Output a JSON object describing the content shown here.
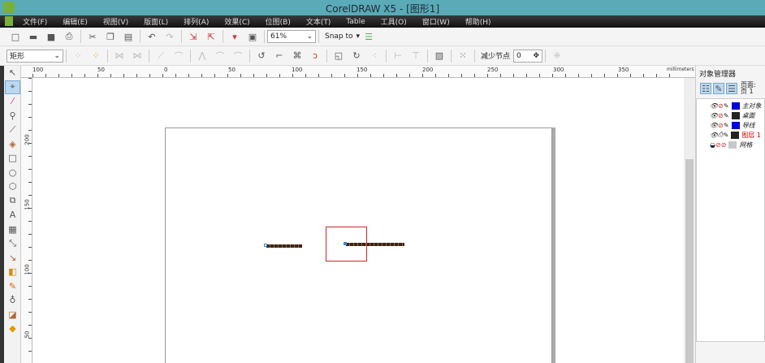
{
  "title": "CorelDRAW X5 - [图形1]",
  "menu": [
    "文件(F)",
    "编辑(E)",
    "视图(V)",
    "版面(L)",
    "排列(A)",
    "效果(C)",
    "位图(B)",
    "文本(T)",
    "Table",
    "工具(O)",
    "窗口(W)",
    "帮助(H)"
  ],
  "toolbar": {
    "zoom": "61%",
    "snap": "Snap to"
  },
  "propbar": {
    "shape_type": "矩形",
    "reduce_nodes_label": "减少节点",
    "reduce_nodes_value": "0"
  },
  "ruler": {
    "h_labels": [
      "100",
      "50",
      "0",
      "50",
      "100",
      "150",
      "200",
      "250",
      "300",
      "350"
    ],
    "units": "millimeters",
    "v_labels": [
      "200",
      "150",
      "100",
      "50"
    ]
  },
  "docker": {
    "title": "对象管理器",
    "page_label": "页面:",
    "page_value": "页 1",
    "layers": [
      {
        "name": "主对象",
        "color": "#0000dd"
      },
      {
        "name": "桌面",
        "color": "#222222"
      },
      {
        "name": "导线",
        "color": "#0000dd"
      },
      {
        "name": "图层 1",
        "color": "#222222",
        "highlight": "#cc0000"
      },
      {
        "name": "网格",
        "color": "#c8c8c8"
      }
    ]
  }
}
